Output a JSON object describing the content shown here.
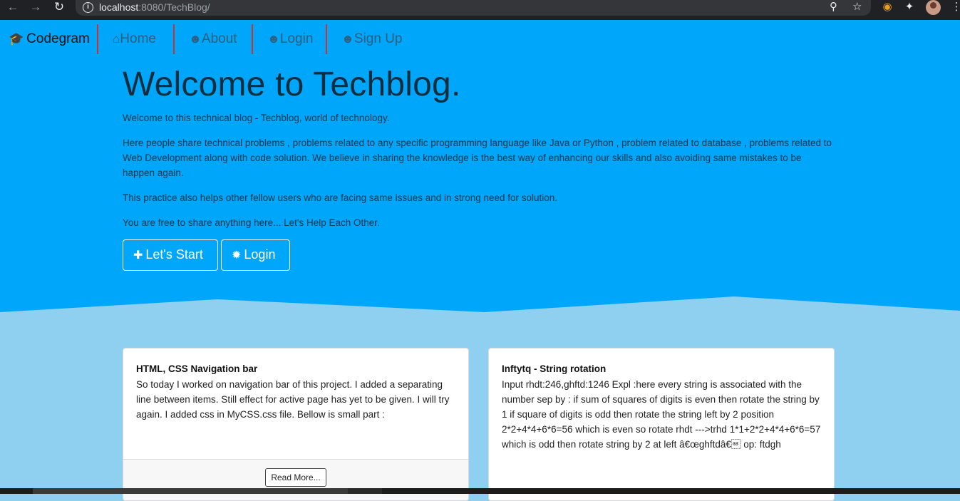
{
  "browser": {
    "url_host": "localhost",
    "url_path": ":8080/TechBlog/",
    "back_icon": "arrow-left-icon",
    "forward_icon": "arrow-right-icon",
    "reload_icon": "reload-icon"
  },
  "navbar": {
    "brand": "Codegram",
    "items": [
      {
        "label": "Home",
        "icon": "home-icon"
      },
      {
        "label": "About",
        "icon": "user-circle-icon"
      },
      {
        "label": "Login",
        "icon": "user-circle-icon"
      },
      {
        "label": "Sign Up",
        "icon": "user-circle-icon"
      }
    ]
  },
  "hero": {
    "title": "Welcome to Techblog.",
    "lead": "Welcome to this technical blog - Techblog, world of technology.",
    "paragraphs": [
      "Here people share technical problems , problems related to any specific programming language like Java or Python , problem related to database , problems related to Web Development along with code solution. We believe in sharing the knowledge is the best way of enhancing our skills and also avoiding same mistakes to be happen again.",
      "This practice also helps other fellow users who are facing same issues and in strong need for solution.",
      "You are free to share anything here... Let's Help Each Other."
    ],
    "start_button": "Let's Start",
    "login_button": "Login"
  },
  "posts": [
    {
      "title": "HTML, CSS Navigation bar",
      "body": "So today I worked on navigation bar of this project. I added a separating line between items. Still effect for active page has yet to be given. I will try again. I added css in MyCSS.css file. Bellow is small part :",
      "read_more": "Read More..."
    },
    {
      "title": "Inftytq - String rotation",
      "body": "Input rhdt:246,ghftd:1246 Expl :here every string is associated with the number sep by : if sum of squares of digits is even then rotate the string by 1 if square of digits is odd then rotate the string left by 2 position 2*2+4*4+6*6=56 which is even so rotate rhdt --->trhd 1*1+2*2+4*4+6*6=57 which is odd then rotate string by 2 at left â€œghftdâ€\u001d op: ftdgh"
    }
  ],
  "colors": {
    "primary": "#00a6f9",
    "secondary": "#8fcff0",
    "divider": "#d03030"
  }
}
